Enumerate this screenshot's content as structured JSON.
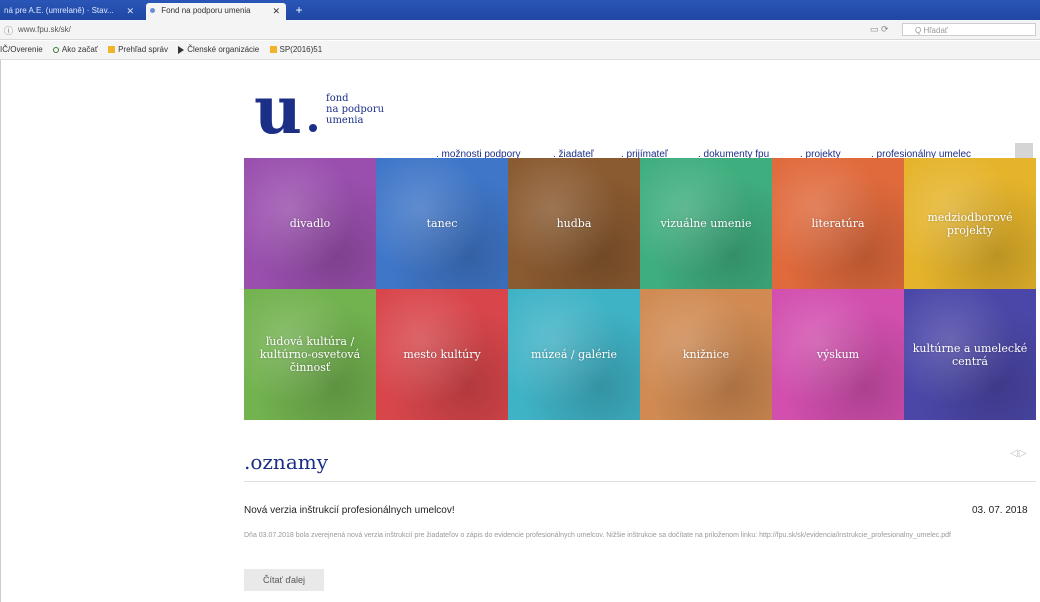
{
  "browser": {
    "tabs": [
      {
        "label": "ná pre A.E. (umrelaně) · Stav..."
      },
      {
        "label": "Fond na podporu umenia"
      }
    ],
    "new_tab": "+",
    "url": "www.fpu.sk/sk/",
    "search_placeholder": "Q Hľadať",
    "bookmarks": [
      {
        "label": "IČ/Overenie"
      },
      {
        "label": "Ako začať"
      },
      {
        "label": "Prehľad správ"
      },
      {
        "label": "Členské organizácie"
      },
      {
        "label": "SP(2016)51"
      }
    ]
  },
  "logo": {
    "letter": "u",
    "lines": [
      "fond",
      "na podporu",
      "umenia"
    ]
  },
  "nav": [
    {
      "label": ". možnosti podpory"
    },
    {
      "label": ". žiadateľ"
    },
    {
      "label": ". prijímateľ"
    },
    {
      "label": ". dokumenty fpu"
    },
    {
      "label": ". projekty"
    },
    {
      "label": ". profesionálny umelec"
    }
  ],
  "tiles": [
    {
      "label": "divadlo",
      "color": "#9a4fae"
    },
    {
      "label": "tanec",
      "color": "#3f76c8"
    },
    {
      "label": "hudba",
      "color": "#8a5a30"
    },
    {
      "label": "vizuálne umenie",
      "color": "#3fae7e"
    },
    {
      "label": "literatúra",
      "color": "#e06a3c"
    },
    {
      "label": "medziodborové projekty",
      "color": "#e5b42b"
    },
    {
      "label": "ľudová kultúra / kultúrno-osvetová činnosť",
      "color": "#72b24f"
    },
    {
      "label": "mesto kultúry",
      "color": "#d8464b"
    },
    {
      "label": "múzeá / galérie",
      "color": "#3fb3c6"
    },
    {
      "label": "knižnice",
      "color": "#d08a52"
    },
    {
      "label": "výskum",
      "color": "#d24fae"
    },
    {
      "label": "kultúrne a umelecké centrá",
      "color": "#4b47a8"
    }
  ],
  "news": {
    "heading": ".oznamy",
    "arrows": "◁▷",
    "title": "Nová verzia inštrukcií profesionálnych umelcov!",
    "date": "03. 07. 2018",
    "description": "Dňa 03.07.2018 bola zverejnená nová verzia inštrukcií pre žiadateľov o zápis do evidencie profesionálnych umelcov. Nižšie inštrukcie sa dočítate na priloženom linku: http://fpu.sk/sk/evidencia/instrukcie_profesionalny_umelec.pdf",
    "button": "Čítať ďalej"
  },
  "colors": {
    "brand": "#1c2f86",
    "tabbar": "#2a56b8"
  }
}
